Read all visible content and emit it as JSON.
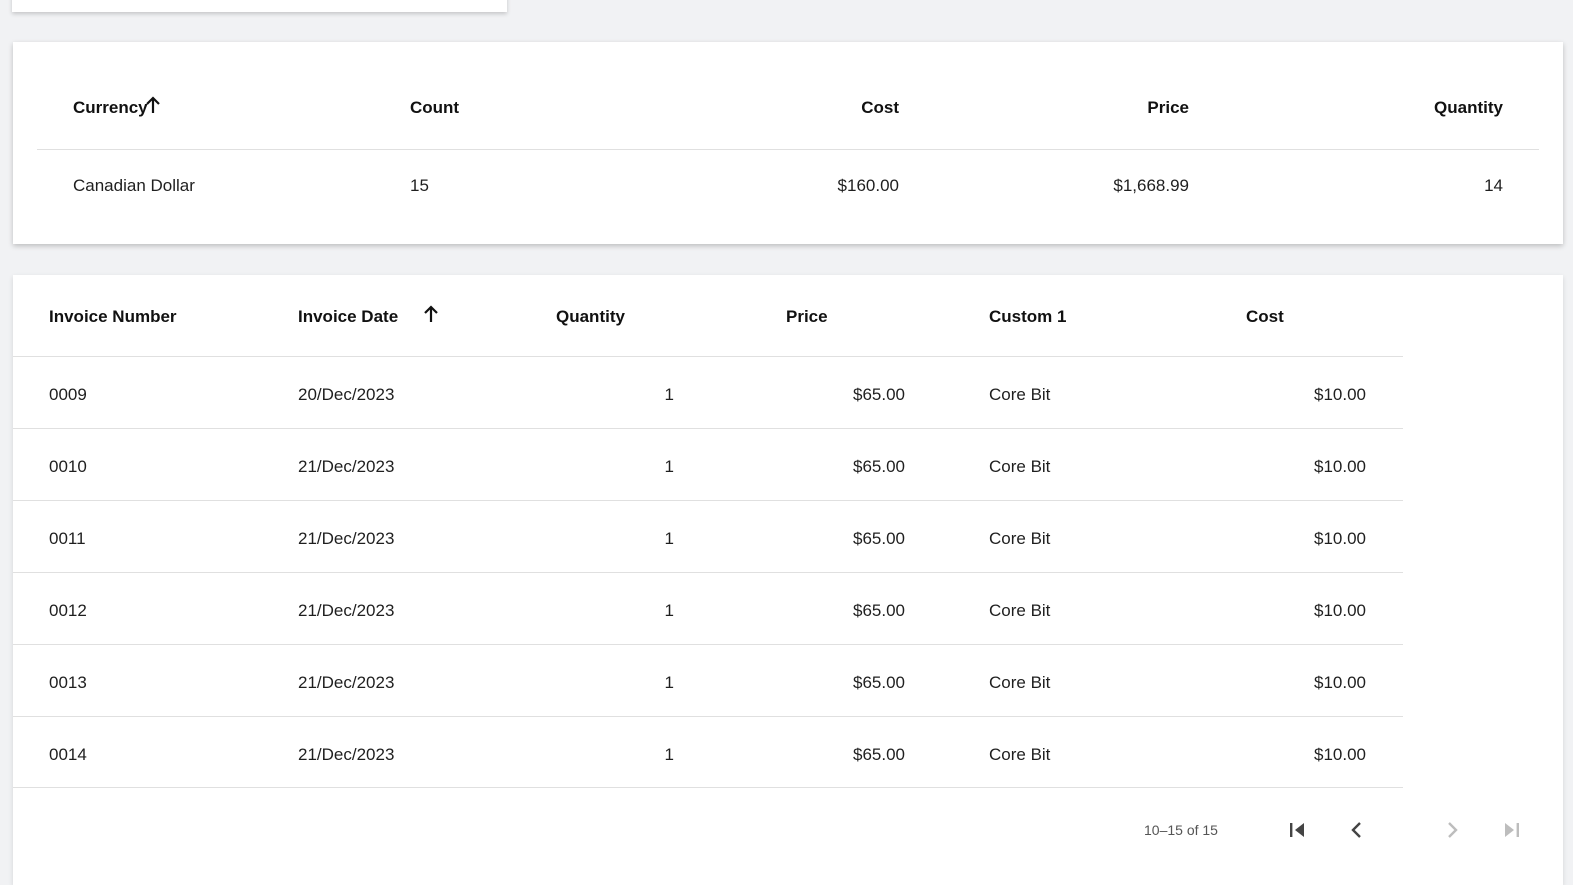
{
  "summary_table": {
    "columns": [
      "Currency",
      "Count",
      "Cost",
      "Price",
      "Quantity"
    ],
    "sort_column": "Currency",
    "rows": [
      [
        "Canadian Dollar",
        "15",
        "$160.00",
        "$1,668.99",
        "14"
      ]
    ]
  },
  "detail_table": {
    "columns": [
      "Invoice Number",
      "Invoice Date",
      "Quantity",
      "Price",
      "Custom 1",
      "Cost"
    ],
    "sort_column": "Invoice Date",
    "rows": [
      [
        "0009",
        "20/Dec/2023",
        "1",
        "$65.00",
        "Core Bit",
        "$10.00"
      ],
      [
        "0010",
        "21/Dec/2023",
        "1",
        "$65.00",
        "Core Bit",
        "$10.00"
      ],
      [
        "0011",
        "21/Dec/2023",
        "1",
        "$65.00",
        "Core Bit",
        "$10.00"
      ],
      [
        "0012",
        "21/Dec/2023",
        "1",
        "$65.00",
        "Core Bit",
        "$10.00"
      ],
      [
        "0013",
        "21/Dec/2023",
        "1",
        "$65.00",
        "Core Bit",
        "$10.00"
      ],
      [
        "0014",
        "21/Dec/2023",
        "1",
        "$65.00",
        "Core Bit",
        "$10.00"
      ]
    ]
  },
  "pagination": {
    "range_text": "10–15 of 15",
    "first_page_icon": "first-page-icon",
    "prev_page_icon": "chevron-left-icon",
    "next_page_icon": "chevron-right-icon",
    "last_page_icon": "last-page-icon"
  }
}
